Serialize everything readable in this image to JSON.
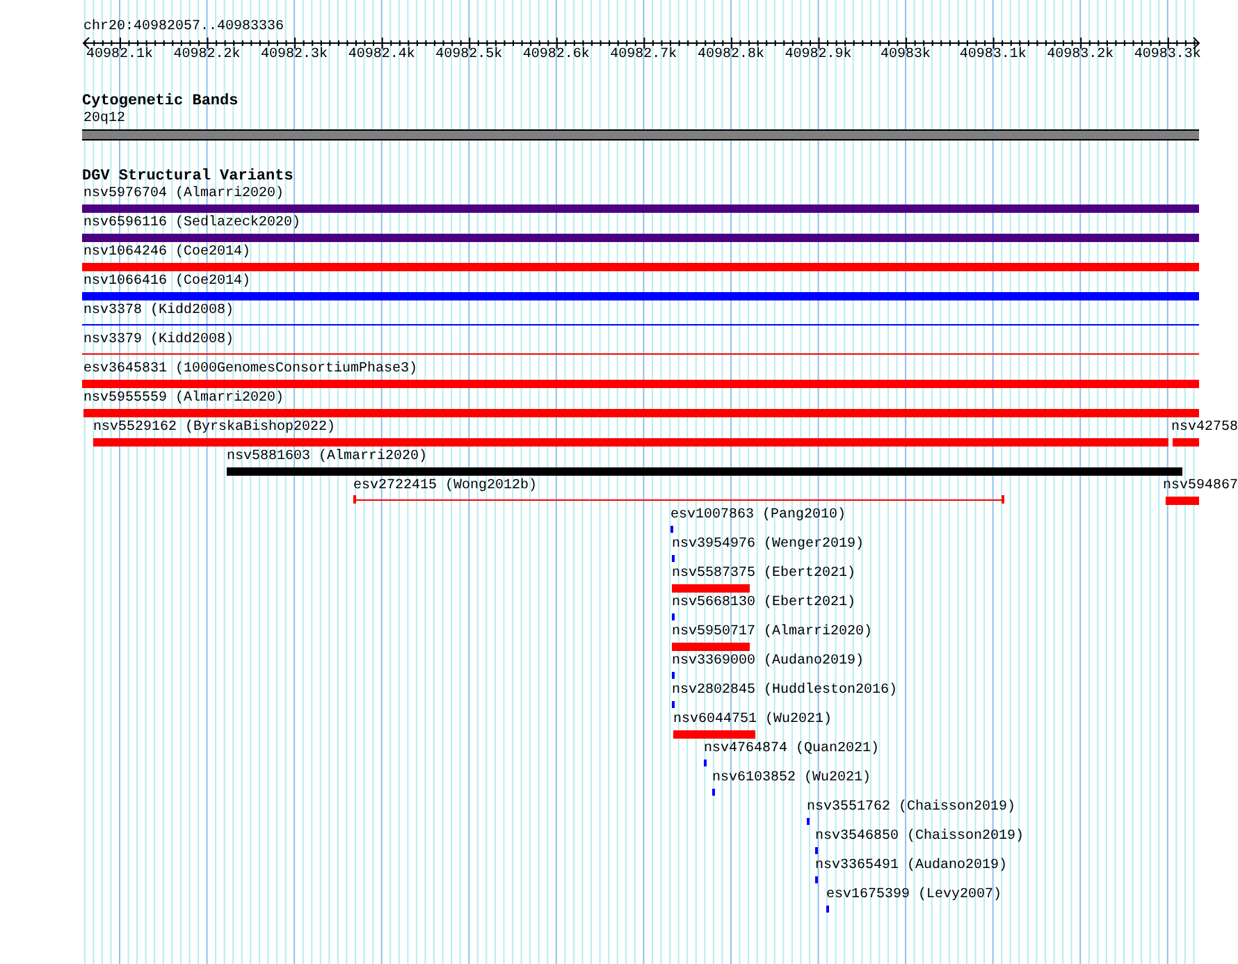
{
  "ruler": {
    "location": "chr20:40982057..40983336",
    "ticks": [
      "40982.1k",
      "40982.2k",
      "40982.3k",
      "40982.4k",
      "40982.5k",
      "40982.6k",
      "40982.7k",
      "40982.8k",
      "40982.9k",
      "40983k",
      "40983.1k",
      "40983.2k",
      "40983.3k"
    ]
  },
  "tracks": [
    {
      "title": "Cytogenetic Bands",
      "features": [
        {
          "label": "20q12",
          "kind": "band",
          "color": "#808080"
        }
      ]
    },
    {
      "title": "DGV Structural Variants",
      "features": [
        {
          "label": "nsv5976704 (Almarri2020)",
          "kind": "bar",
          "color": "#4b0082"
        },
        {
          "label": "nsv6596116 (Sedlazeck2020)",
          "kind": "bar",
          "color": "#4b0082"
        },
        {
          "label": "nsv1064246 (Coe2014)",
          "kind": "bar",
          "color": "#ff0000"
        },
        {
          "label": "nsv1066416 (Coe2014)",
          "kind": "bar",
          "color": "#0000ff"
        },
        {
          "label": "nsv3378 (Kidd2008)",
          "kind": "line",
          "color": "#0000ff"
        },
        {
          "label": "nsv3379 (Kidd2008)",
          "kind": "line",
          "color": "#ff0000"
        },
        {
          "label": "esv3645831 (1000GenomesConsortiumPhase3)",
          "kind": "bar",
          "color": "#ff0000"
        },
        {
          "label": "nsv5955559 (Almarri2020)",
          "kind": "bar",
          "color": "#ff0000"
        },
        {
          "label": "nsv5529162 (ByrskaBishop2022)",
          "kind": "bar",
          "color": "#ff0000"
        },
        {
          "label": "nsv42758",
          "kind": "bar",
          "color": "#ff0000"
        },
        {
          "label": "nsv5881603 (Almarri2020)",
          "kind": "bar",
          "color": "#000000"
        },
        {
          "label": "esv2722415 (Wong2012b)",
          "kind": "range",
          "color": "#ff0000"
        },
        {
          "label": "nsv594867",
          "kind": "bar",
          "color": "#ff0000"
        },
        {
          "label": "esv1007863 (Pang2010)",
          "kind": "tick",
          "color": "#0000ff"
        },
        {
          "label": "nsv3954976 (Wenger2019)",
          "kind": "tick",
          "color": "#0000ff"
        },
        {
          "label": "nsv5587375 (Ebert2021)",
          "kind": "bar",
          "color": "#ff0000"
        },
        {
          "label": "nsv5668130 (Ebert2021)",
          "kind": "tick",
          "color": "#0000ff"
        },
        {
          "label": "nsv5950717 (Almarri2020)",
          "kind": "bar",
          "color": "#ff0000"
        },
        {
          "label": "nsv3369000 (Audano2019)",
          "kind": "tick",
          "color": "#0000ff"
        },
        {
          "label": "nsv2802845 (Huddleston2016)",
          "kind": "tick",
          "color": "#0000ff"
        },
        {
          "label": "nsv6044751 (Wu2021)",
          "kind": "bar",
          "color": "#ff0000"
        },
        {
          "label": "nsv4764874 (Quan2021)",
          "kind": "tick",
          "color": "#0000ff"
        },
        {
          "label": "nsv6103852 (Wu2021)",
          "kind": "tick",
          "color": "#0000ff"
        },
        {
          "label": "nsv3551762 (Chaisson2019)",
          "kind": "tick",
          "color": "#0000ff"
        },
        {
          "label": "nsv3546850 (Chaisson2019)",
          "kind": "tick",
          "color": "#0000ff"
        },
        {
          "label": "nsv3365491 (Audano2019)",
          "kind": "tick",
          "color": "#0000ff"
        },
        {
          "label": "esv1675399 (Levy2007)",
          "kind": "tick",
          "color": "#0000ff"
        }
      ]
    }
  ]
}
